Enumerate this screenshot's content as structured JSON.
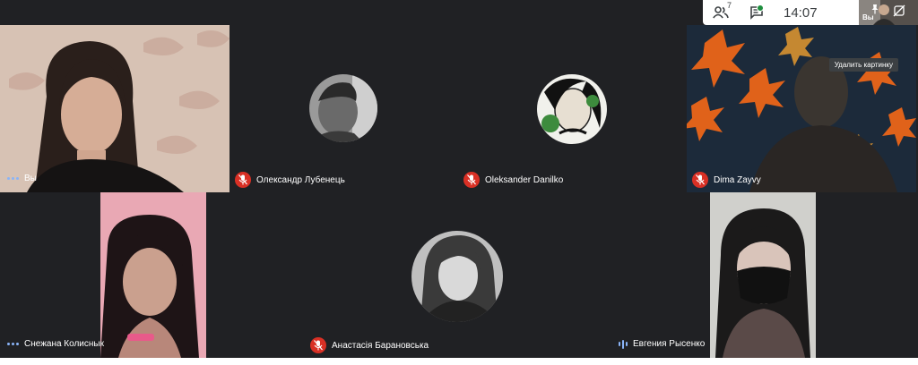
{
  "topbar": {
    "people_count": "7",
    "time": "14:07",
    "self_label": "Вы",
    "remove_picture_label": "Удалить картинку"
  },
  "participants": [
    {
      "name": "Вы",
      "status": "speaking-dots"
    },
    {
      "name": "Олександр Лубенець",
      "status": "muted"
    },
    {
      "name": "Oleksander Danilko",
      "status": "muted"
    },
    {
      "name": "Dima Zayvy",
      "status": "muted"
    },
    {
      "name": "Снежана Колиснык",
      "status": "speaking-dots"
    },
    {
      "name": "Анастасія Барановська",
      "status": "muted"
    },
    {
      "name": "Евгения Рысенко",
      "status": "audio-bars"
    }
  ],
  "colors": {
    "stage_bg": "#202124",
    "muted_red": "#d93025",
    "accent_blue": "#8ab4f8"
  }
}
